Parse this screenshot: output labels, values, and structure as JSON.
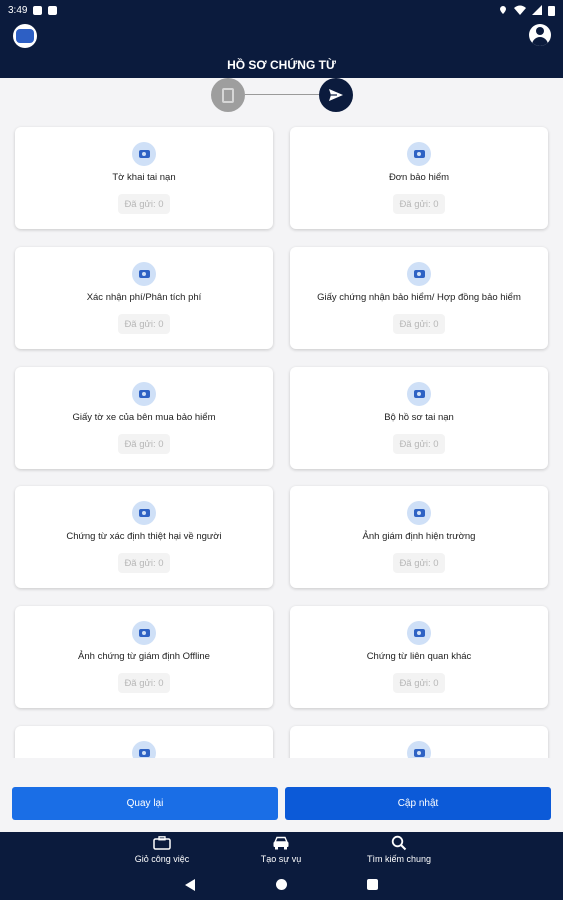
{
  "status_bar": {
    "time": "3:49"
  },
  "header": {
    "title": "HỒ SƠ CHỨNG TỪ",
    "logo_icon": "logo-icon",
    "profile_icon": "account-circle-icon"
  },
  "stepper": {
    "step1_icon": "document-icon",
    "step2_icon": "send-icon"
  },
  "cards": [
    {
      "label": "Tờ khai tai nạn",
      "badge": "Đã gửi: 0"
    },
    {
      "label": "Đơn bảo hiểm",
      "badge": "Đã gửi: 0"
    },
    {
      "label": "Xác nhận phí/Phân tích phí",
      "badge": "Đã gửi: 0"
    },
    {
      "label": "Giấy chứng nhận bảo hiểm/ Hợp đồng bảo hiểm",
      "badge": "Đã gửi: 0"
    },
    {
      "label": "Giấy tờ xe của bên mua bảo hiểm",
      "badge": "Đã gửi: 0"
    },
    {
      "label": "Bộ hồ sơ tai nạn",
      "badge": "Đã gửi: 0"
    },
    {
      "label": "Chứng từ xác định thiệt hại về người",
      "badge": "Đã gửi: 0"
    },
    {
      "label": "Ảnh giám định hiện trường",
      "badge": "Đã gửi: 0"
    },
    {
      "label": "Ảnh chứng từ giám định Offline",
      "badge": "Đã gửi: 0"
    },
    {
      "label": "Chứng từ liên quan khác",
      "badge": "Đã gửi: 0"
    },
    {
      "label": "",
      "badge": ""
    },
    {
      "label": "",
      "badge": ""
    }
  ],
  "actions": {
    "back_label": "Quay lại",
    "update_label": "Cập nhật"
  },
  "bottom_nav": [
    {
      "label": "Giỏ công việc",
      "icon": "briefcase-icon"
    },
    {
      "label": "Tạo sự vụ",
      "icon": "car-icon"
    },
    {
      "label": "Tìm kiếm chung",
      "icon": "search-icon"
    }
  ],
  "colors": {
    "header_bg": "#0b1b3d",
    "accent": "#1a6ee6",
    "camera_icon": "#2e62c4"
  }
}
